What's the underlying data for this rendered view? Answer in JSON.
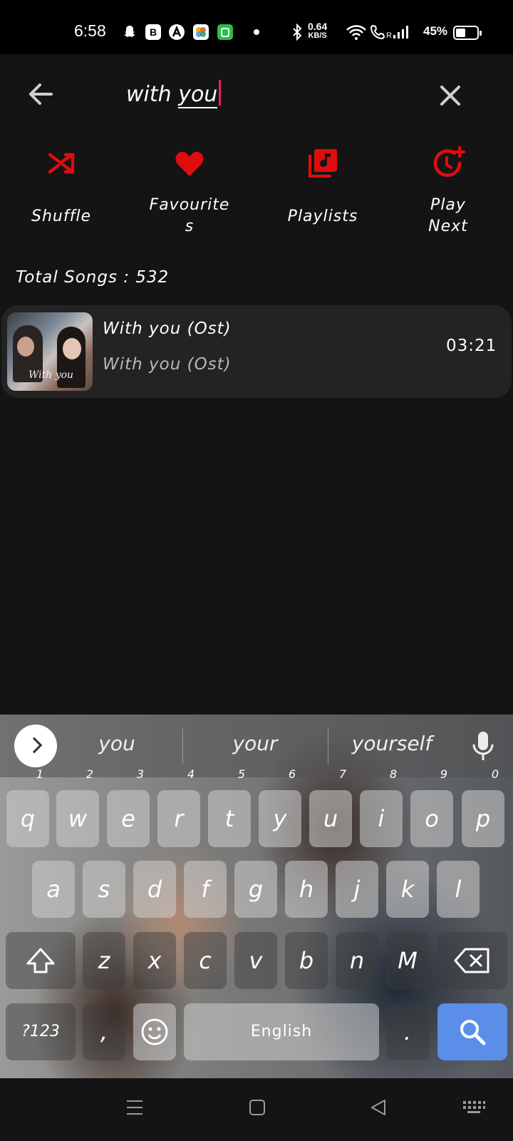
{
  "status_bar": {
    "time": "6:58",
    "net_speed_value": "0.64",
    "net_speed_unit": "KB/S",
    "battery": "45%"
  },
  "search": {
    "query_plain": "with ",
    "query_underlined": "you"
  },
  "actions": {
    "shuffle": "Shuffle",
    "favourites_line1": "Favourite",
    "favourites_line2": "s",
    "playlists": "Playlists",
    "play_next_line1": "Play",
    "play_next_line2": "Next"
  },
  "total_songs": "Total Songs : 532",
  "song": {
    "title": "With you (Ost)",
    "subtitle": "With you (Ost)",
    "duration": "03:21",
    "art_text": "With you"
  },
  "keyboard": {
    "suggestions": [
      "you",
      "your",
      "yourself"
    ],
    "row1": [
      {
        "k": "q",
        "n": "1"
      },
      {
        "k": "w",
        "n": "2"
      },
      {
        "k": "e",
        "n": "3"
      },
      {
        "k": "r",
        "n": "4"
      },
      {
        "k": "t",
        "n": "5"
      },
      {
        "k": "y",
        "n": "6"
      },
      {
        "k": "u",
        "n": "7"
      },
      {
        "k": "i",
        "n": "8"
      },
      {
        "k": "o",
        "n": "9"
      },
      {
        "k": "p",
        "n": "0"
      }
    ],
    "row2": [
      "a",
      "s",
      "d",
      "f",
      "g",
      "h",
      "j",
      "k",
      "l"
    ],
    "row3": [
      "z",
      "x",
      "c",
      "v",
      "b",
      "n",
      "M"
    ],
    "symbols_key": "?123",
    "comma_key": ",",
    "space_key": "English",
    "period_key": "."
  },
  "colors": {
    "accent_red": "#e00d0d",
    "caret_pink": "#e91e63",
    "search_key_blue": "#5b8ee8",
    "background": "#141414"
  }
}
